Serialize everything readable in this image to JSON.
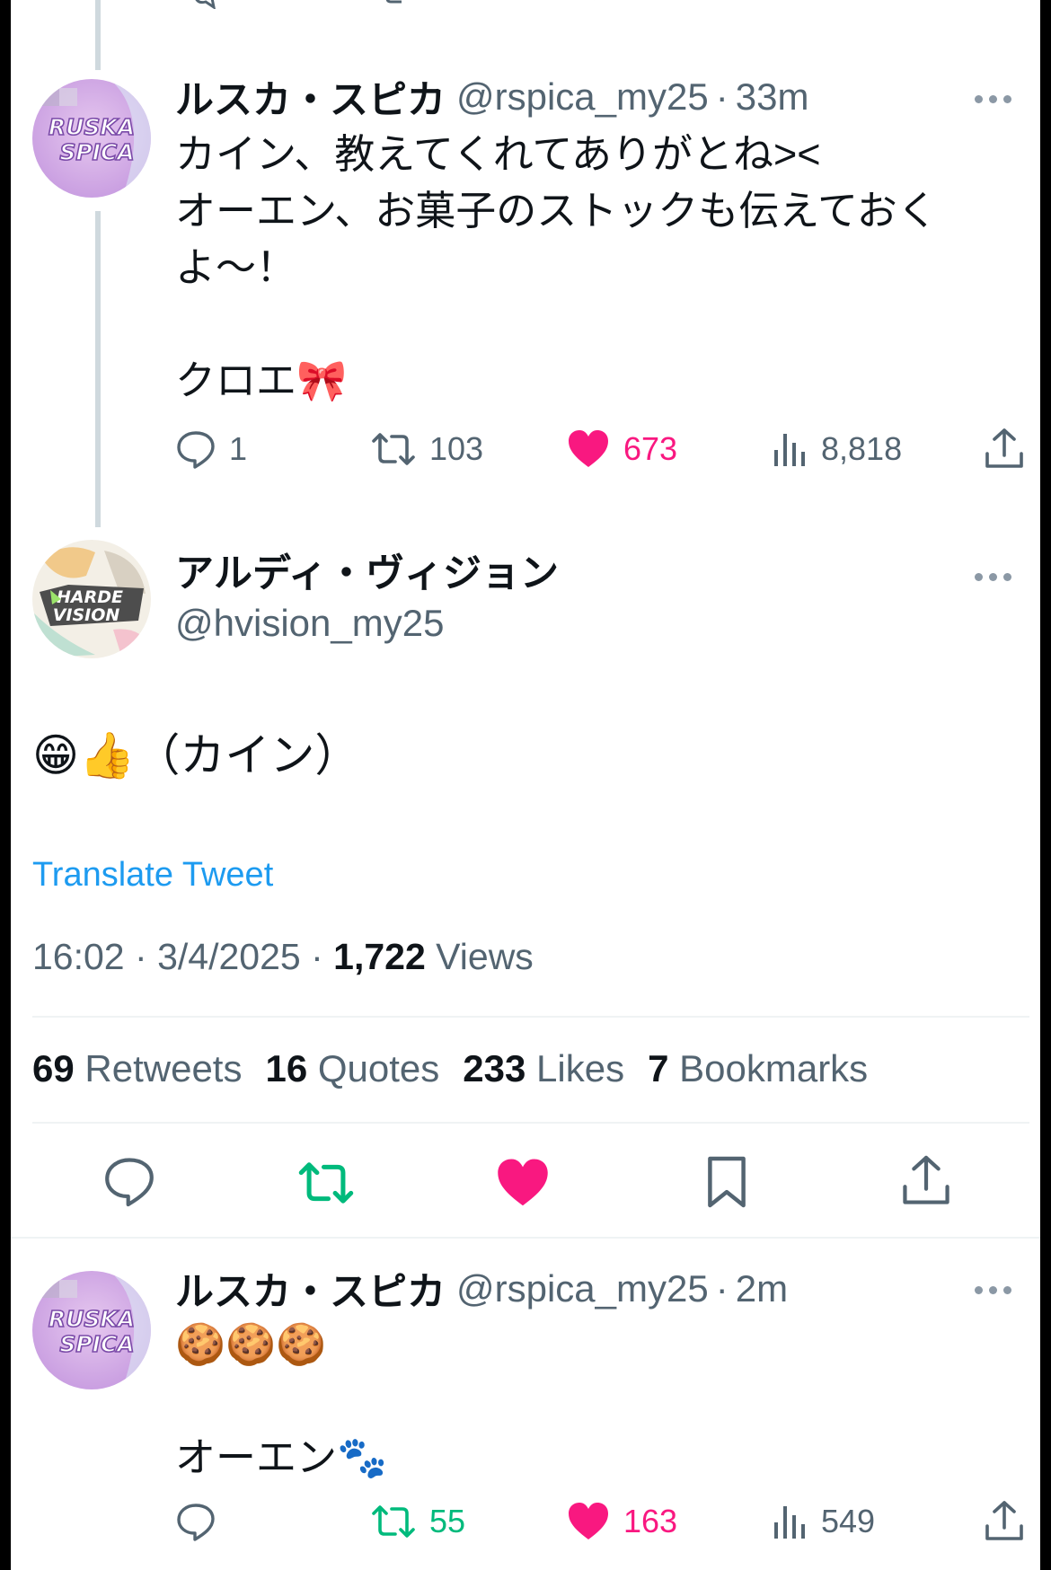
{
  "tweet1": {
    "name": "ルスカ・スピカ",
    "handle": "@rspica_my25",
    "time": "33m",
    "avatar_text": [
      "RUSKA",
      "SPICA"
    ],
    "body": [
      "カイン、教えてくれてありがとね><",
      "オーエン、お菓子のストックも伝えておく",
      "よ～！",
      "",
      "クロエ🎀"
    ],
    "replies": "1",
    "retweets": "103",
    "likes": "673",
    "views": "8,818"
  },
  "tweet2": {
    "name": "アルディ・ヴィジョン",
    "handle": "@hvision_my25",
    "avatar_text": [
      "HARDE",
      "VISION"
    ],
    "body": "😁👍（カイン）",
    "translate": "Translate Tweet",
    "time": "16:02",
    "date": "3/4/2025",
    "views_count": "1,722",
    "views_label": "Views",
    "stats": [
      {
        "num": "69",
        "label": "Retweets"
      },
      {
        "num": "16",
        "label": "Quotes"
      },
      {
        "num": "233",
        "label": "Likes"
      },
      {
        "num": "7",
        "label": "Bookmarks"
      }
    ]
  },
  "tweet3": {
    "name": "ルスカ・スピカ",
    "handle": "@rspica_my25",
    "time": "2m",
    "avatar_text": [
      "RUSKA",
      "SPICA"
    ],
    "body": [
      "🍪🍪🍪",
      "",
      "オーエン🐾"
    ],
    "retweets": "55",
    "likes": "163",
    "views": "549"
  },
  "separator": "·",
  "colors": {
    "like": "#f91880",
    "retweet": "#00ba7c",
    "link": "#1d9bf0",
    "muted": "#536471"
  },
  "icons": [
    "reply-icon",
    "retweet-icon",
    "like-icon",
    "views-icon",
    "share-icon",
    "bookmark-icon",
    "more-icon"
  ]
}
